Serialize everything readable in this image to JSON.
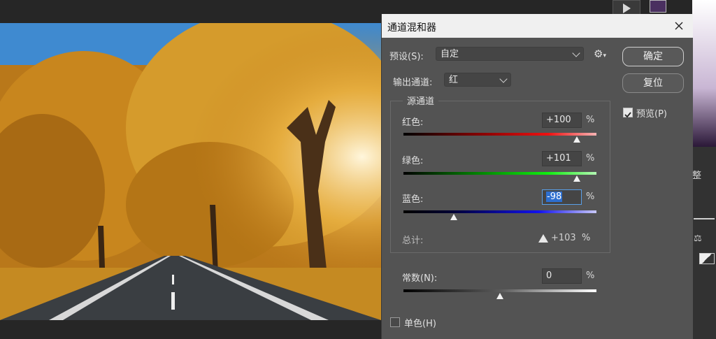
{
  "dialog": {
    "title": "通道混和器",
    "preset_label": "预设(S):",
    "preset_value": "自定",
    "output_label": "输出通道:",
    "output_value": "红",
    "ok_label": "确定",
    "reset_label": "复位",
    "preview_label": "预览(P)",
    "preview_checked": true,
    "source_group_label": "源通道",
    "channels": [
      {
        "label": "红色:",
        "value": "+100",
        "unit": "%",
        "level": 0.9
      },
      {
        "label": "绿色:",
        "value": "+101",
        "unit": "%",
        "level": 0.9
      },
      {
        "label": "蓝色:",
        "value": "-98",
        "unit": "%",
        "level": 0.26
      }
    ],
    "total_label": "总计:",
    "total_value": "+103",
    "total_unit": "%",
    "constant_label": "常数(N):",
    "constant_value": "0",
    "constant_unit": "%",
    "constant_level": 0.5,
    "monochrome_label": "单色(H)",
    "monochrome_checked": false
  },
  "right_panel": {
    "partial_label": "整"
  }
}
